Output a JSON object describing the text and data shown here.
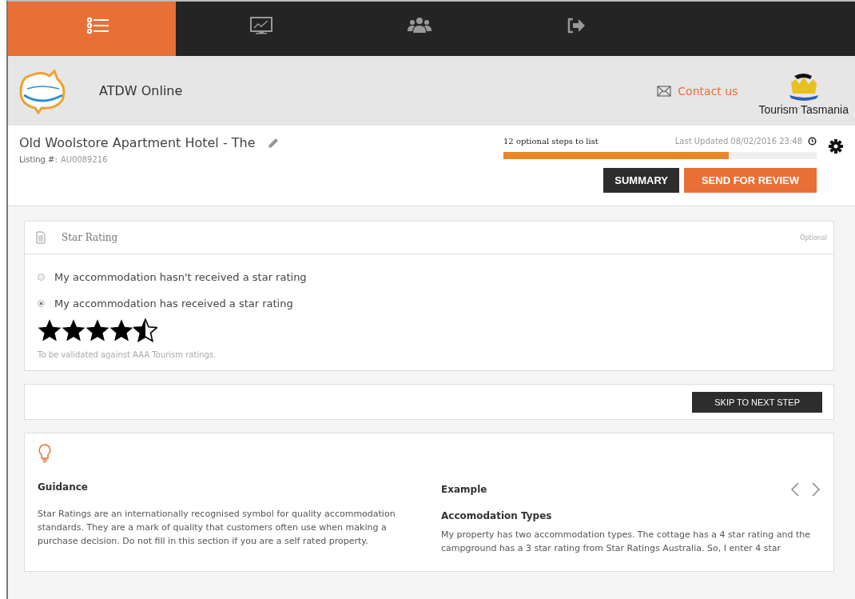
{
  "nav_tabs": [
    {
      "kind": "list",
      "selected": true
    },
    {
      "kind": "monitor",
      "selected": false
    },
    {
      "kind": "users",
      "selected": false
    },
    {
      "kind": "logout",
      "selected": false
    }
  ],
  "header": {
    "app_name": "ATDW Online",
    "contact": "Contact us",
    "partner": "Tourism Tasmania"
  },
  "listing": {
    "title": "Old Woolstore Apartment Hotel - The",
    "number_label": "Listing #:",
    "number": "AU0089216",
    "steps": "12 optional steps to list",
    "last_updated_label": "Last Updated",
    "last_updated": "08/02/2016 23:48",
    "progress": {
      "level": 0.72
    },
    "buttons": [
      {
        "label": "SUMMARY",
        "kind": "dark"
      },
      {
        "label": "SEND FOR REVIEW",
        "kind": "primary"
      }
    ]
  },
  "star_section": {
    "title": "Star Rating",
    "badge": "Optional",
    "options": [
      {
        "label": "My accommodation hasn't received a star rating",
        "selected": false
      },
      {
        "label": "My accommodation has received a star rating",
        "selected": true
      }
    ],
    "rating": {
      "stars": 4.5
    },
    "note": "To be validated against AAA Tourism ratings."
  },
  "skip_button": "SKIP TO NEXT STEP",
  "guidance": {
    "title": "Guidance",
    "text": "Star Ratings are an internationally recognised symbol for quality accommodation standards. They are a mark of quality that customers often use when making a purchase decision. Do not fill in this section if you are a self rated property.",
    "example_title": "Example",
    "example_heading": "Accomodation Types",
    "example_text": "My property has two accommodation types. The cottage has a 4 star rating and the campground has a 3 star rating from Star Ratings Australia. So, I enter 4 star"
  }
}
